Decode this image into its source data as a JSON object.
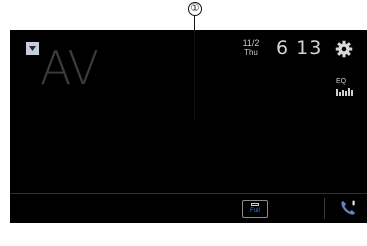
{
  "callout": {
    "number": "①"
  },
  "header": {
    "source_label": "AV",
    "source_toggle_icon": "triangle-down-icon",
    "date": {
      "month_day": "11/2",
      "weekday": "Thu"
    },
    "time": "6 13",
    "settings_icon": "gear-icon"
  },
  "eq": {
    "label": "EQ",
    "icon": "eq-bars-icon"
  },
  "footer": {
    "aspect_button_label": "Full",
    "phone_icon": "phone-icon"
  },
  "colors": {
    "screen_bg": "#000000",
    "accent_blue": "#3f78d0",
    "text_dim": "#3c3c3c",
    "text_light": "#d4d4d4"
  }
}
